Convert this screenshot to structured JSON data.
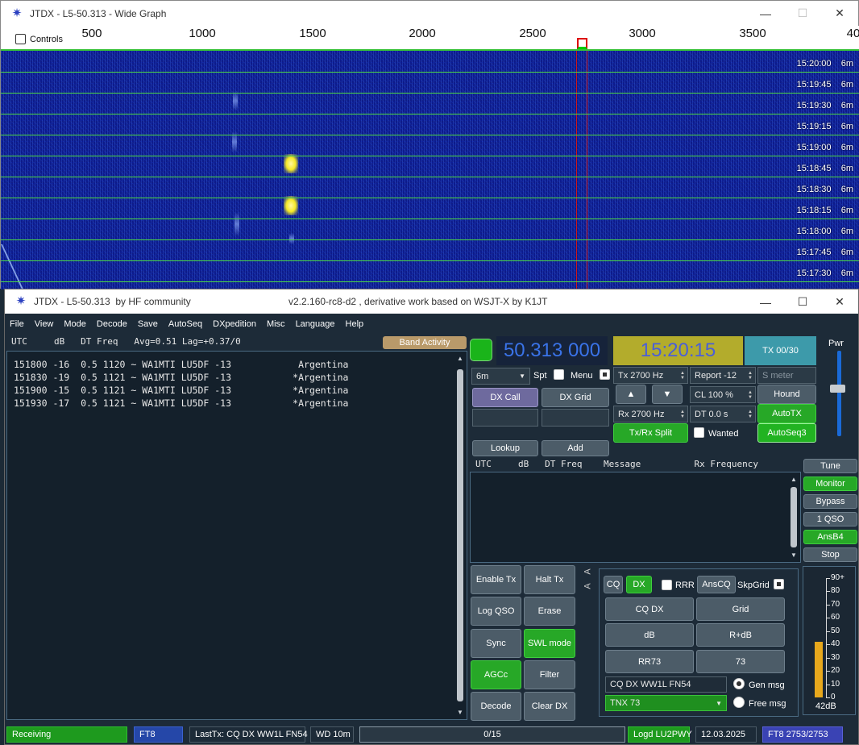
{
  "wide_graph": {
    "title": "JTDX - L5-50.313 - Wide Graph",
    "controls_label": "Controls",
    "freq_scale": [
      "500",
      "1000",
      "1500",
      "2000",
      "2500",
      "3000",
      "3500",
      "40"
    ],
    "rows": [
      {
        "time": "15:20:00",
        "band": "6m"
      },
      {
        "time": "15:19:45",
        "band": "6m"
      },
      {
        "time": "15:19:30",
        "band": "6m"
      },
      {
        "time": "15:19:15",
        "band": "6m"
      },
      {
        "time": "15:19:00",
        "band": "6m"
      },
      {
        "time": "15:18:45",
        "band": "6m"
      },
      {
        "time": "15:18:30",
        "band": "6m"
      },
      {
        "time": "15:18:15",
        "band": "6m"
      },
      {
        "time": "15:18:00",
        "band": "6m"
      },
      {
        "time": "15:17:45",
        "band": "6m"
      },
      {
        "time": "15:17:30",
        "band": "6m"
      }
    ]
  },
  "main_window": {
    "title": "JTDX - L5-50.313  by HF community",
    "subtitle": "v2.2.160-rc8-d2 , derivative work based on WSJT-X by K1JT",
    "menu": [
      "File",
      "View",
      "Mode",
      "Decode",
      "Save",
      "AutoSeq",
      "DXpedition",
      "Misc",
      "Language",
      "Help"
    ]
  },
  "band_activity": {
    "header": "UTC     dB   DT Freq   Avg=0.51 Lag=+0.37/0",
    "button": "Band Activity",
    "lines": [
      "151800 -16  0.5 1120 ~ WA1MTI LU5DF -13            Argentina",
      "151830 -19  0.5 1121 ~ WA1MTI LU5DF -13           *Argentina",
      "151900 -15  0.5 1121 ~ WA1MTI LU5DF -13           *Argentina",
      "151930 -17  0.5 1121 ~ WA1MTI LU5DF -13           *Argentina"
    ]
  },
  "controls": {
    "frequency": "50.313 000",
    "clock": "15:20:15",
    "tx_counter": "TX 00/30",
    "pwr_label": "Pwr",
    "band": "6m",
    "spt_label": "Spt",
    "menu_label": "Menu",
    "tx_freq": "Tx  2700  Hz",
    "rx_freq": "Rx  2700  Hz",
    "report": "Report  -12",
    "s_meter": "S meter",
    "cl": "CL  100  %",
    "dt": "DT  0.0  s",
    "dx_call": "DX Call",
    "dx_grid": "DX Grid",
    "hound": "Hound",
    "autotx": "AutoTX",
    "up_arrow": "▲",
    "down_arrow": "▼",
    "tx_rx_split": "Tx/Rx Split",
    "wanted": "Wanted",
    "autoseq3": "AutoSeq3",
    "lookup": "Lookup",
    "add": "Add"
  },
  "rx_panel": {
    "header": "UTC     dB   DT Freq    Message          Rx Frequency",
    "side_buttons": [
      "Tune",
      "Monitor",
      "Bypass",
      "1 QSO",
      "AnsB4",
      "Stop"
    ]
  },
  "action_buttons": [
    "Enable Tx",
    "Halt Tx",
    "Log QSO",
    "Erase",
    "Sync",
    "SWL mode",
    "AGCc",
    "Filter",
    "Decode",
    "Clear DX"
  ],
  "tab_panel": {
    "tab_labels": [
      "A",
      "A"
    ],
    "cq": "CQ",
    "dx": "DX",
    "rrr": "RRR",
    "anscq": "AnsCQ",
    "skpgrid": "SkpGrid",
    "cq_dx": "CQ DX",
    "grid": "Grid",
    "db": "dB",
    "r_db": "R+dB",
    "rr73": "RR73",
    "73": "73",
    "gen_msg_value": "CQ DX WW1L FN54",
    "gen_msg_label": "Gen msg",
    "free_msg_value": "TNX 73",
    "free_msg_label": "Free msg"
  },
  "meter": {
    "labels": [
      "90+",
      "80",
      "70",
      "60",
      "50",
      "40",
      "30",
      "20",
      "10",
      "0"
    ],
    "level_db": 42,
    "db_label": "42dB"
  },
  "status_bar": {
    "receiving": "Receiving",
    "mode": "FT8",
    "last_tx": "LastTx: CQ DX WW1L FN54",
    "wd": "WD 10m",
    "progress": "0/15",
    "logd": "Logd LU2PWY",
    "date": "12.03.2025",
    "ft8_count": "FT8  2753/2753"
  }
}
